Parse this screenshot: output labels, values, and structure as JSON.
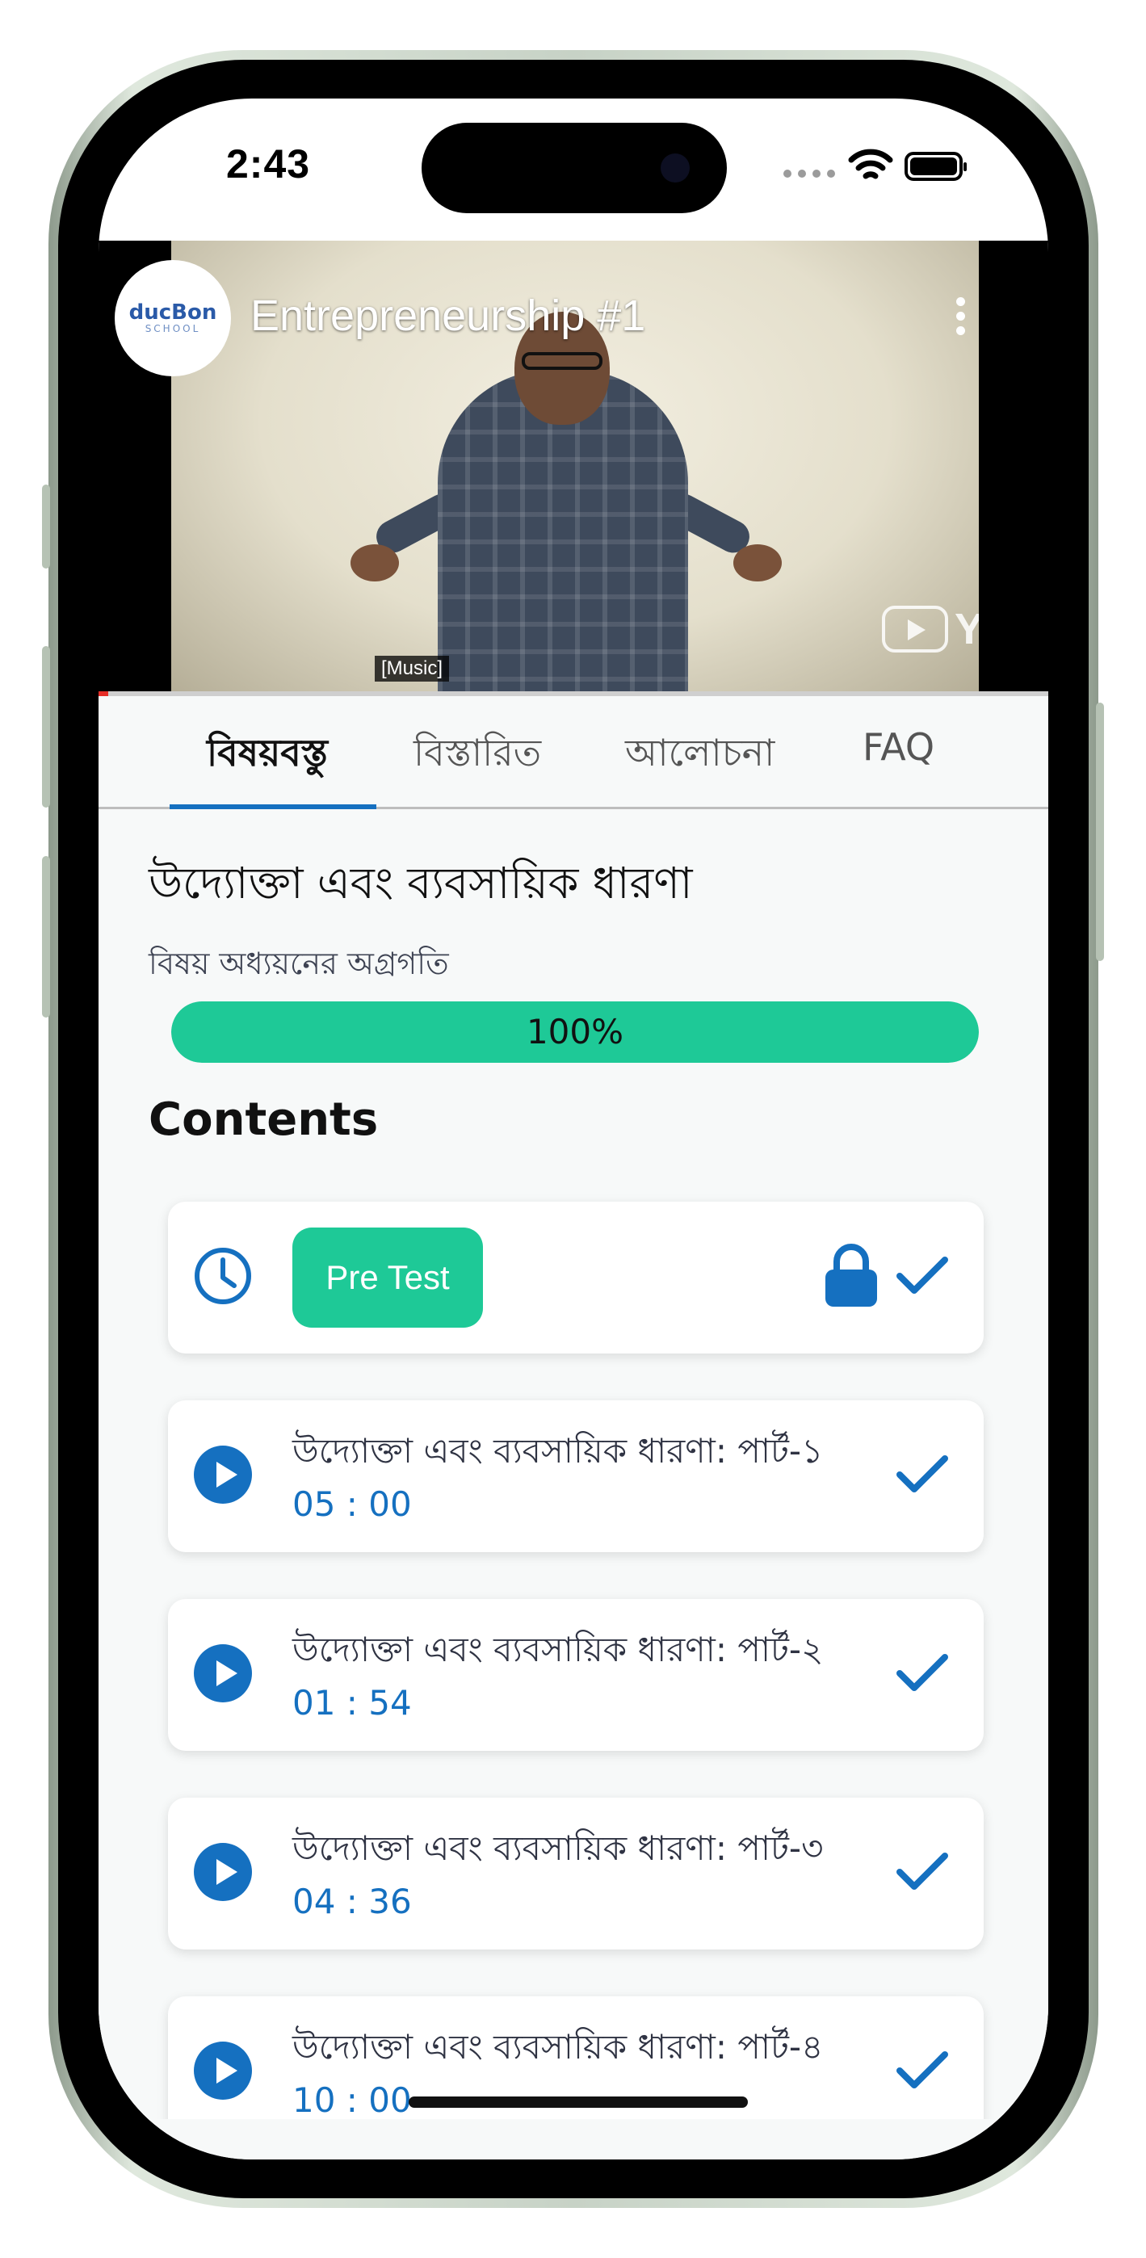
{
  "status_bar": {
    "time": "2:43"
  },
  "video": {
    "channel_logo_text": "ducBon",
    "channel_logo_sub": "SCHOOL",
    "title": "Entrepreneurship #1",
    "caption": "[Music]",
    "youtube_label": "YouTube"
  },
  "tabs": [
    {
      "label": "বিষয়বস্তু",
      "active": true
    },
    {
      "label": "বিস্তারিত",
      "active": false
    },
    {
      "label": "আলোচনা",
      "active": false
    },
    {
      "label": "FAQ",
      "active": false
    }
  ],
  "course": {
    "title": "উদ্যোক্তা এবং ব্যবসায়িক ধারণা",
    "progress_label": "বিষয় অধ্যয়নের অগ্রগতি",
    "progress_value": 100,
    "progress_text": "100%",
    "progress_color": "#1ec997"
  },
  "contents": {
    "heading": "Contents",
    "pre_test": {
      "label": "Pre Test",
      "icon": "clock-icon",
      "locked": true,
      "completed": true
    },
    "items": [
      {
        "title": "উদ্যোক্তা এবং ব্যবসায়িক ধারণা: পার্ট-১",
        "duration": "05 : 00",
        "icon": "play-icon",
        "completed": true
      },
      {
        "title": "উদ্যোক্তা এবং ব্যবসায়িক ধারণা: পার্ট-২",
        "duration": "01 : 54",
        "icon": "play-icon",
        "completed": true
      },
      {
        "title": "উদ্যোক্তা এবং ব্যবসায়িক ধারণা: পার্ট-৩",
        "duration": "04 : 36",
        "icon": "play-icon",
        "completed": true
      },
      {
        "title": "উদ্যোক্তা এবং ব্যবসায়িক ধারণা: পার্ট-৪",
        "duration": "10 : 00",
        "icon": "play-icon",
        "completed": true
      }
    ]
  },
  "colors": {
    "accent": "#1570c0",
    "success": "#1ec997"
  }
}
